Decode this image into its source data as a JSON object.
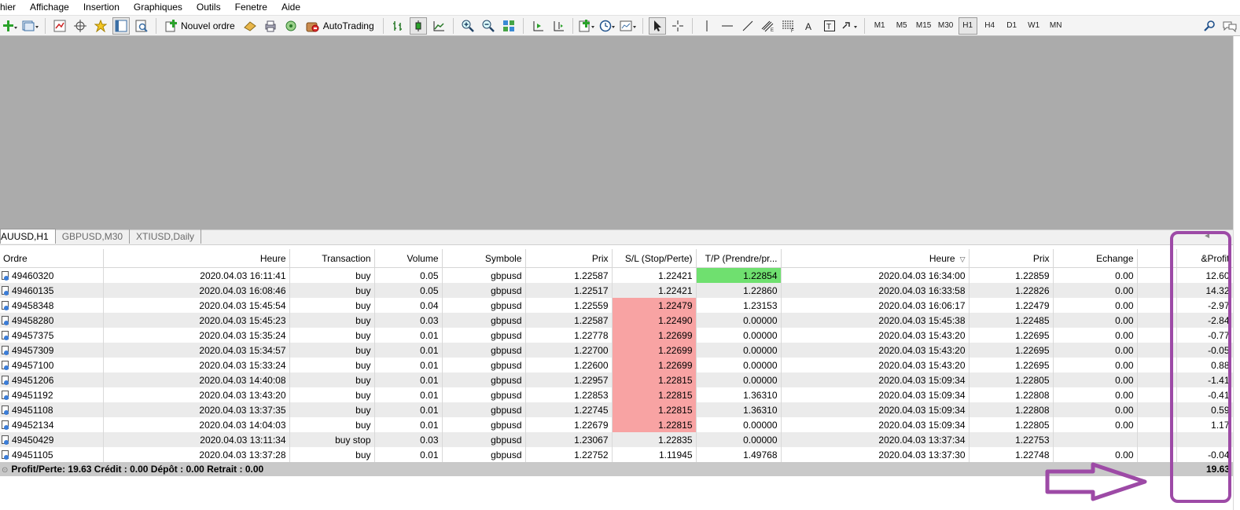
{
  "menu": [
    "hier",
    "Affichage",
    "Insertion",
    "Graphiques",
    "Outils",
    "Fenetre",
    "Aide"
  ],
  "toolbar": {
    "new_order_label": "Nouvel ordre",
    "autotrading_label": "AutoTrading",
    "timeframes": [
      "M1",
      "M5",
      "M15",
      "M30",
      "H1",
      "H4",
      "D1",
      "W1",
      "MN"
    ],
    "active_timeframe": "H1"
  },
  "chart_tabs": [
    "AUUSD,H1",
    "GBPUSD,M30",
    "XTIUSD,Daily"
  ],
  "table": {
    "headers": [
      "Ordre",
      "Heure",
      "Transaction",
      "Volume",
      "Symbole",
      "Prix",
      "S/L (Stop/Perte)",
      "T/P (Prendre/pr...",
      "Heure",
      "Prix",
      "Echange",
      "",
      "&Profit"
    ],
    "rows": [
      {
        "order": "49460320",
        "open_time": "2020.04.03 16:11:41",
        "type": "buy",
        "volume": "0.05",
        "symbol": "gbpusd",
        "price": "1.22587",
        "sl": "1.22421",
        "tp": "1.22854",
        "close_time": "2020.04.03 16:34:00",
        "close_price": "1.22859",
        "swap": "0.00",
        "profit": "12.60",
        "sl_hit": false,
        "tp_hit": true
      },
      {
        "order": "49460135",
        "open_time": "2020.04.03 16:08:46",
        "type": "buy",
        "volume": "0.05",
        "symbol": "gbpusd",
        "price": "1.22517",
        "sl": "1.22421",
        "tp": "1.22860",
        "close_time": "2020.04.03 16:33:58",
        "close_price": "1.22826",
        "swap": "0.00",
        "profit": "14.32",
        "sl_hit": false,
        "tp_hit": false
      },
      {
        "order": "49458348",
        "open_time": "2020.04.03 15:45:54",
        "type": "buy",
        "volume": "0.04",
        "symbol": "gbpusd",
        "price": "1.22559",
        "sl": "1.22479",
        "tp": "1.23153",
        "close_time": "2020.04.03 16:06:17",
        "close_price": "1.22479",
        "swap": "0.00",
        "profit": "-2.97",
        "sl_hit": true,
        "tp_hit": false
      },
      {
        "order": "49458280",
        "open_time": "2020.04.03 15:45:23",
        "type": "buy",
        "volume": "0.03",
        "symbol": "gbpusd",
        "price": "1.22587",
        "sl": "1.22490",
        "tp": "0.00000",
        "close_time": "2020.04.03 15:45:38",
        "close_price": "1.22485",
        "swap": "0.00",
        "profit": "-2.84",
        "sl_hit": true,
        "tp_hit": false
      },
      {
        "order": "49457375",
        "open_time": "2020.04.03 15:35:24",
        "type": "buy",
        "volume": "0.01",
        "symbol": "gbpusd",
        "price": "1.22778",
        "sl": "1.22699",
        "tp": "0.00000",
        "close_time": "2020.04.03 15:43:20",
        "close_price": "1.22695",
        "swap": "0.00",
        "profit": "-0.77",
        "sl_hit": true,
        "tp_hit": false
      },
      {
        "order": "49457309",
        "open_time": "2020.04.03 15:34:57",
        "type": "buy",
        "volume": "0.01",
        "symbol": "gbpusd",
        "price": "1.22700",
        "sl": "1.22699",
        "tp": "0.00000",
        "close_time": "2020.04.03 15:43:20",
        "close_price": "1.22695",
        "swap": "0.00",
        "profit": "-0.05",
        "sl_hit": true,
        "tp_hit": false
      },
      {
        "order": "49457100",
        "open_time": "2020.04.03 15:33:24",
        "type": "buy",
        "volume": "0.01",
        "symbol": "gbpusd",
        "price": "1.22600",
        "sl": "1.22699",
        "tp": "0.00000",
        "close_time": "2020.04.03 15:43:20",
        "close_price": "1.22695",
        "swap": "0.00",
        "profit": "0.88",
        "sl_hit": true,
        "tp_hit": false
      },
      {
        "order": "49451206",
        "open_time": "2020.04.03 14:40:08",
        "type": "buy",
        "volume": "0.01",
        "symbol": "gbpusd",
        "price": "1.22957",
        "sl": "1.22815",
        "tp": "0.00000",
        "close_time": "2020.04.03 15:09:34",
        "close_price": "1.22805",
        "swap": "0.00",
        "profit": "-1.41",
        "sl_hit": true,
        "tp_hit": false
      },
      {
        "order": "49451192",
        "open_time": "2020.04.03 13:43:20",
        "type": "buy",
        "volume": "0.01",
        "symbol": "gbpusd",
        "price": "1.22853",
        "sl": "1.22815",
        "tp": "1.36310",
        "close_time": "2020.04.03 15:09:34",
        "close_price": "1.22808",
        "swap": "0.00",
        "profit": "-0.41",
        "sl_hit": true,
        "tp_hit": false
      },
      {
        "order": "49451108",
        "open_time": "2020.04.03 13:37:35",
        "type": "buy",
        "volume": "0.01",
        "symbol": "gbpusd",
        "price": "1.22745",
        "sl": "1.22815",
        "tp": "1.36310",
        "close_time": "2020.04.03 15:09:34",
        "close_price": "1.22808",
        "swap": "0.00",
        "profit": "0.59",
        "sl_hit": true,
        "tp_hit": false
      },
      {
        "order": "49452134",
        "open_time": "2020.04.03 14:04:03",
        "type": "buy",
        "volume": "0.01",
        "symbol": "gbpusd",
        "price": "1.22679",
        "sl": "1.22815",
        "tp": "0.00000",
        "close_time": "2020.04.03 15:09:34",
        "close_price": "1.22805",
        "swap": "0.00",
        "profit": "1.17",
        "sl_hit": true,
        "tp_hit": false
      },
      {
        "order": "49450429",
        "open_time": "2020.04.03 13:11:34",
        "type": "buy stop",
        "volume": "0.03",
        "symbol": "gbpusd",
        "price": "1.23067",
        "sl": "1.22835",
        "tp": "0.00000",
        "close_time": "2020.04.03 13:37:34",
        "close_price": "1.22753",
        "swap": "",
        "profit": "",
        "sl_hit": false,
        "tp_hit": false
      },
      {
        "order": "49451105",
        "open_time": "2020.04.03 13:37:28",
        "type": "buy",
        "volume": "0.01",
        "symbol": "gbpusd",
        "price": "1.22752",
        "sl": "1.11945",
        "tp": "1.49768",
        "close_time": "2020.04.03 13:37:30",
        "close_price": "1.22748",
        "swap": "0.00",
        "profit": "-0.04",
        "sl_hit": false,
        "tp_hit": false
      }
    ],
    "summary_text": "Profit/Perte: 19.63  Crédit : 0.00  Dépôt : 0.00  Retrait : 0.00",
    "summary_profit": "19.63"
  },
  "colors": {
    "sl_highlight": "#f8a3a3",
    "tp_highlight": "#6fe06f",
    "annotation": "#9d4aa6",
    "chart_background": "#ababab"
  }
}
